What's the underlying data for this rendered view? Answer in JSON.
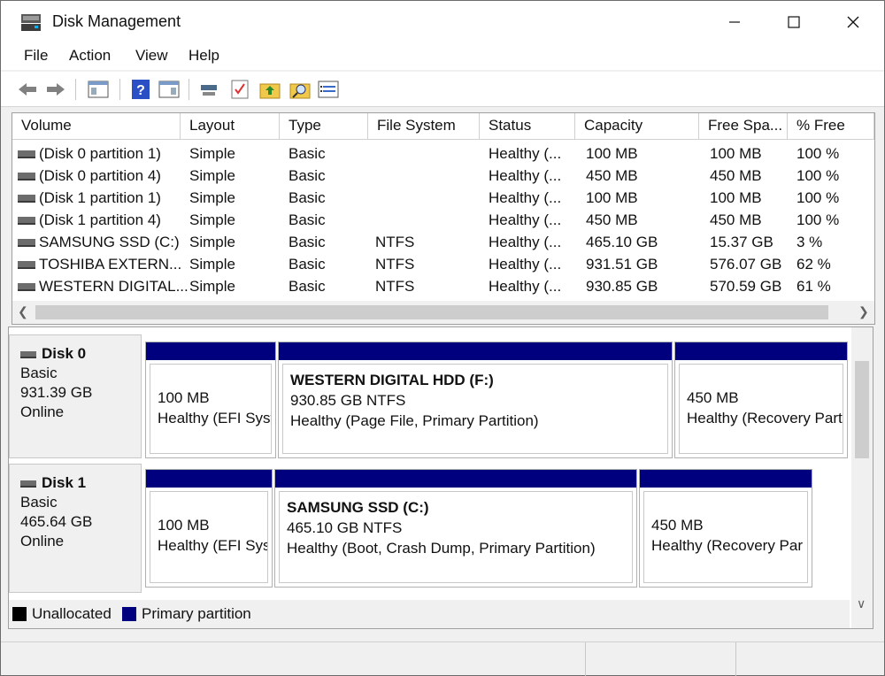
{
  "window": {
    "title": "Disk Management",
    "app_icon": "disk-management-icon"
  },
  "menu": [
    "File",
    "Action",
    "View",
    "Help"
  ],
  "toolbar": [
    "back-icon",
    "forward-icon",
    "console-tree-icon",
    "help-icon",
    "properties-icon",
    "connect-icon",
    "checklist-icon",
    "up-folder-icon",
    "search-icon",
    "list-icon"
  ],
  "volume_table": {
    "headers": [
      "Volume",
      "Layout",
      "Type",
      "File System",
      "Status",
      "Capacity",
      "Free Spa...",
      "% Free"
    ],
    "rows": [
      [
        "(Disk 0 partition 1)",
        "Simple",
        "Basic",
        "",
        "Healthy (...",
        "100 MB",
        "100 MB",
        "100 %"
      ],
      [
        "(Disk 0 partition 4)",
        "Simple",
        "Basic",
        "",
        "Healthy (...",
        "450 MB",
        "450 MB",
        "100 %"
      ],
      [
        "(Disk 1 partition 1)",
        "Simple",
        "Basic",
        "",
        "Healthy (...",
        "100 MB",
        "100 MB",
        "100 %"
      ],
      [
        "(Disk 1 partition 4)",
        "Simple",
        "Basic",
        "",
        "Healthy (...",
        "450 MB",
        "450 MB",
        "100 %"
      ],
      [
        "SAMSUNG SSD (C:)",
        "Simple",
        "Basic",
        "NTFS",
        "Healthy (...",
        "465.10 GB",
        "15.37 GB",
        "3 %"
      ],
      [
        "TOSHIBA EXTERN...",
        "Simple",
        "Basic",
        "NTFS",
        "Healthy (...",
        "931.51 GB",
        "576.07 GB",
        "62 %"
      ],
      [
        "WESTERN DIGITAL...",
        "Simple",
        "Basic",
        "NTFS",
        "Healthy (...",
        "930.85 GB",
        "570.59 GB",
        "61 %"
      ]
    ]
  },
  "disks": [
    {
      "name": "Disk 0",
      "type": "Basic",
      "size": "931.39 GB",
      "status": "Online",
      "partitions": [
        {
          "name": "",
          "size": "100 MB",
          "status": "Healthy (EFI Syst"
        },
        {
          "name": "WESTERN DIGITAL HDD  (F:)",
          "size": "930.85 GB NTFS",
          "status": "Healthy (Page File, Primary Partition)"
        },
        {
          "name": "",
          "size": "450 MB",
          "status": "Healthy (Recovery Part"
        }
      ]
    },
    {
      "name": "Disk 1",
      "type": "Basic",
      "size": "465.64 GB",
      "status": "Online",
      "partitions": [
        {
          "name": "",
          "size": "100 MB",
          "status": "Healthy (EFI Sys"
        },
        {
          "name": "SAMSUNG SSD  (C:)",
          "size": "465.10 GB NTFS",
          "status": "Healthy (Boot, Crash Dump, Primary Partition)"
        },
        {
          "name": "",
          "size": "450 MB",
          "status": "Healthy (Recovery Par"
        }
      ]
    }
  ],
  "legend": [
    {
      "label": "Unallocated",
      "color": "#000000"
    },
    {
      "label": "Primary partition",
      "color": "#00007f"
    }
  ]
}
